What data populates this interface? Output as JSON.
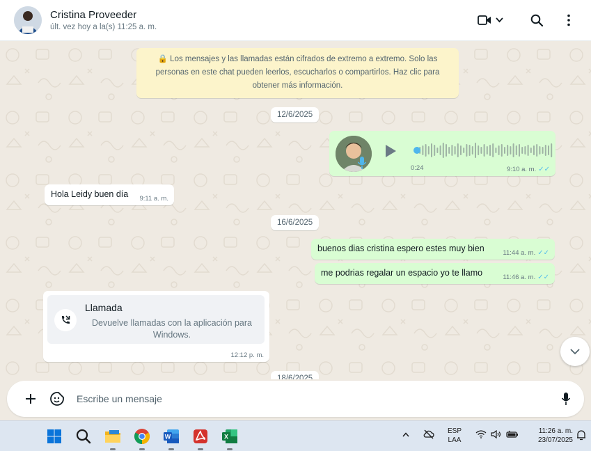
{
  "header": {
    "contact_name": "Cristina Proveeder",
    "last_seen": "últ. vez hoy a la(s) 11:25 a. m.",
    "icons": [
      "video-call-icon",
      "chevron-down-icon",
      "search-icon",
      "menu-icon"
    ]
  },
  "chat": {
    "encryption_notice": "🔒 Los mensajes y las llamadas están cifrados de extremo a extremo. Solo las personas en este chat pueden leerlos, escucharlos o compartirlos. Haz clic para obtener más información.",
    "dates": [
      "12/6/2025",
      "16/6/2025",
      "18/6/2025"
    ],
    "voice_note": {
      "duration": "0:24",
      "time": "9:10 a. m.",
      "progress": 0.02
    },
    "messages": [
      {
        "text": "Hola Leidy buen día",
        "time": "9:11 a. m.",
        "direction": "in"
      },
      {
        "text": "buenos dias cristina espero estes muy bien",
        "time": "11:44 a. m.",
        "direction": "out"
      },
      {
        "text": "me podrias regalar un espacio yo te llamo",
        "time": "11:46 a. m.",
        "direction": "out"
      }
    ],
    "call": {
      "title": "Llamada",
      "description": "Devuelve llamadas con la aplicación para Windows.",
      "time": "12:12 p. m."
    },
    "ticks": "✓✓"
  },
  "composer": {
    "placeholder": "Escribe un mensaje",
    "icons": [
      "plus-icon",
      "sticker-icon",
      "microphone-icon"
    ]
  },
  "taskbar": {
    "apps": [
      "windows-start-icon",
      "search-icon",
      "file-explorer-icon",
      "chrome-icon",
      "word-icon",
      "acrobat-icon",
      "excel-icon"
    ],
    "language_line1": "ESP",
    "language_line2": "LAA",
    "time": "11:26 a. m.",
    "date": "23/07/2025"
  },
  "colors": {
    "outgoing_bubble": "#d9fdd3",
    "incoming_bubble": "#ffffff",
    "notice_bg": "#fcf4cb",
    "read_ticks": "#53bdeb",
    "chat_bg": "#efeae2"
  }
}
